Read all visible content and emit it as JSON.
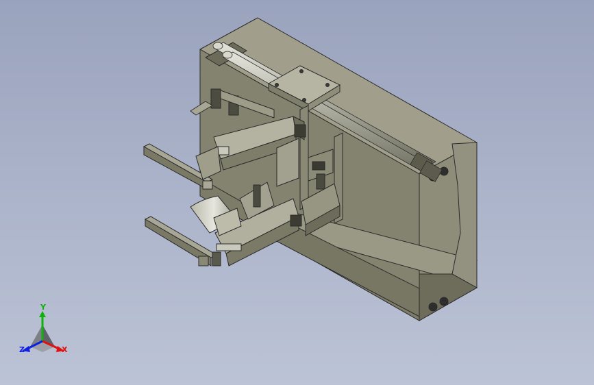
{
  "viewport": {
    "background_top": "#9aa3bd",
    "background_bottom": "#bcc3d6"
  },
  "model": {
    "body_color": "#8c8b78",
    "edge_color": "#2a2a2a",
    "highlight_color": "#c9c9bd"
  },
  "triad": {
    "x_label": "X",
    "y_label": "Y",
    "z_label": "Z",
    "x_color": "#e01010",
    "y_color": "#10b010",
    "z_color": "#1020e0"
  }
}
